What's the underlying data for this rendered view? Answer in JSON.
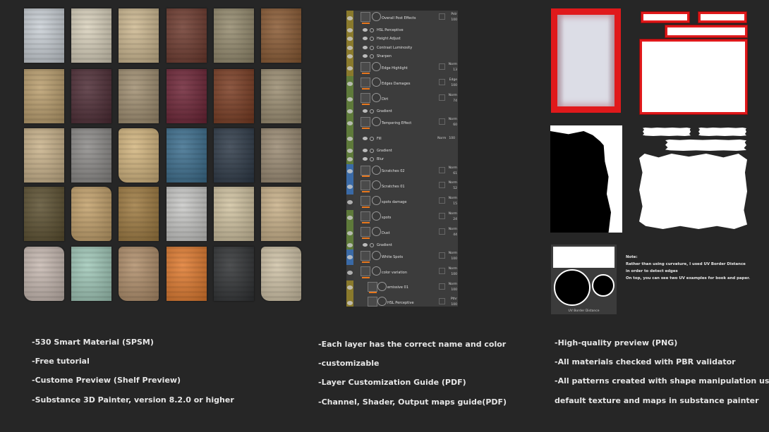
{
  "colors": {
    "background": "#262626",
    "layer_yellow": "#8a7a2c",
    "layer_green": "#5e7a3a",
    "layer_blue": "#3a6aa6",
    "accent_orange": "#e8781e",
    "accent_red": "#e0191b"
  },
  "gallery": {
    "tiles": [
      "#c9cfd5",
      "#d8d0bb",
      "#cdb890",
      "#6e3a2e",
      "#948a6d",
      "#8a5a33",
      "#ba9e6d",
      "#4e2c35",
      "#a08e70",
      "#6e2436",
      "#7a3c22",
      "#9a8c70",
      "#c9b28a",
      "#8c8a88",
      "#d3b57e",
      "#3c6e8e",
      "#2e3a48",
      "#9a8a72",
      "#5c5030",
      "#c2a06a",
      "#9e7a40",
      "#c8c8c6",
      "#d0c2a0",
      "#c8b088",
      "#c6b8b0",
      "#a0c8b8",
      "#b08e6a",
      "#e07a2e",
      "#303234",
      "#cfc2a6"
    ]
  },
  "layers": [
    {
      "type": "folder",
      "name": "Overall Post Effects",
      "color": "#8a7a2c",
      "blend": "Pstr",
      "opacity": "100"
    },
    {
      "type": "effect",
      "name": "HSL Perceptive",
      "color": "#8a7a2c"
    },
    {
      "type": "effect",
      "name": "Height Adjust",
      "color": "#8a7a2c"
    },
    {
      "type": "effect",
      "name": "Contrast Luminosity",
      "color": "#8a7a2c"
    },
    {
      "type": "effect",
      "name": "Sharpen",
      "color": "#8a7a2c"
    },
    {
      "type": "layer",
      "name": "Edge Highlight",
      "color": "#8a7a2c",
      "blend": "Norm",
      "opacity": "13"
    },
    {
      "type": "layer",
      "name": "Edges Damages",
      "color": "#5e7a3a",
      "blend": "Edge",
      "opacity": "100"
    },
    {
      "type": "layer",
      "name": "Dirt",
      "color": "#5e7a3a",
      "blend": "Norm",
      "opacity": "74"
    },
    {
      "type": "effect",
      "name": "Gradient",
      "color": "#5e7a3a"
    },
    {
      "type": "layer",
      "name": "Tempering Effect",
      "color": "#5e7a3a",
      "blend": "Norm",
      "opacity": "60"
    },
    {
      "type": "fill",
      "name": "Fill",
      "color": "#5e7a3a",
      "blend": "Norm",
      "opacity": "100"
    },
    {
      "type": "effect",
      "name": "Gradient",
      "color": "#5e7a3a"
    },
    {
      "type": "effect",
      "name": "Blur",
      "color": "#5e7a3a"
    },
    {
      "type": "layer",
      "name": "Scratches 02",
      "color": "#3a6aa6",
      "blend": "Norm",
      "opacity": "61"
    },
    {
      "type": "layer",
      "name": "Scratches 01",
      "color": "#3a6aa6",
      "blend": "Norm",
      "opacity": "52"
    },
    {
      "type": "layer",
      "name": "spots damage",
      "color": "#3a3a3a",
      "blend": "Norm",
      "opacity": "15"
    },
    {
      "type": "layer",
      "name": "spots",
      "color": "#5e7a3a",
      "blend": "Norm",
      "opacity": "24"
    },
    {
      "type": "layer",
      "name": "Dust",
      "color": "#5e7a3a",
      "blend": "Norm",
      "opacity": "44"
    },
    {
      "type": "effect",
      "name": "Gradient",
      "color": "#5e7a3a"
    },
    {
      "type": "layer",
      "name": "White Spots",
      "color": "#3a6aa6",
      "blend": "Norm",
      "opacity": "100"
    },
    {
      "type": "folder",
      "name": "color variation",
      "color": "#3a3a3a",
      "blend": "Norm",
      "opacity": "100"
    },
    {
      "type": "sublayer",
      "name": "emissive 01",
      "color": "#8a7a2c",
      "blend": "Norm",
      "opacity": "100"
    },
    {
      "type": "sublayer",
      "name": "HSL Perceptive",
      "color": "#8a7a2c",
      "blend": "Pthr",
      "opacity": "100"
    },
    {
      "type": "sublayer",
      "name": "",
      "color": "#8a7a2c",
      "blend": "",
      "opacity": ""
    }
  ],
  "uv": {
    "caption": "UV Border Distance"
  },
  "note": {
    "title": "Note:",
    "lines": [
      "Rather than using curvature, I used UV Border Distance",
      "in order to detect edges",
      "On top, you can see two UV examples for book and paper."
    ]
  },
  "features": {
    "col1": [
      "-530 Smart Material  (SPSM)",
      "-Free tutorial",
      "-Custome Preview (Shelf Preview)",
      "-Substance 3D Painter, version 8.2.0 or higher"
    ],
    "col2": [
      "-Each layer has the correct name and color",
      "-customizable",
      "-Layer Customization Guide (PDF)",
      "-Channel, Shader, Output maps guide(PDF)"
    ],
    "col3": [
      "-High-quality preview (PNG)",
      "-All materials checked with PBR validator",
      "-All patterns created with shape manipulation using",
      "default texture and maps in substance painter"
    ]
  }
}
